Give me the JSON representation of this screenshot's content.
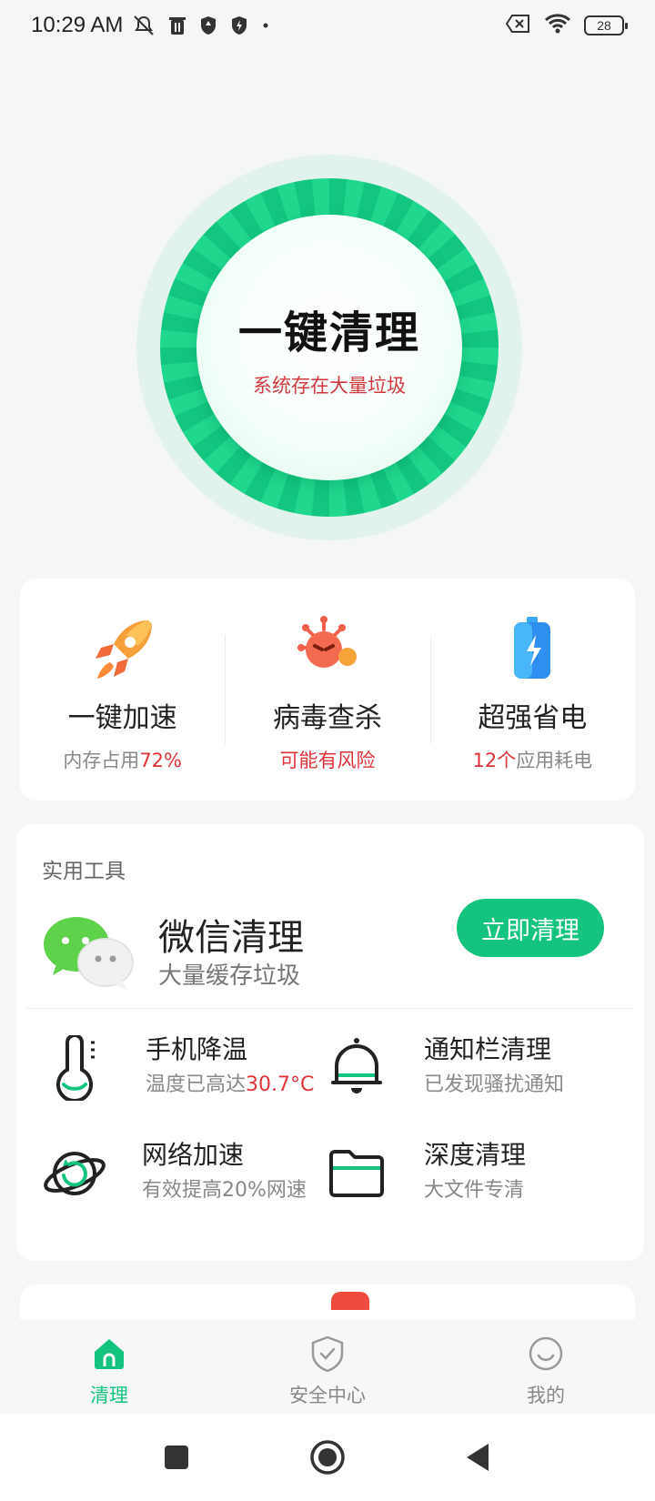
{
  "status_bar": {
    "time": "10:29 AM",
    "left_icons": [
      "mute-icon",
      "trash-icon",
      "shield-icon",
      "shield-bolt-icon",
      "dot-icon"
    ],
    "right_icons": [
      "sim-off-icon",
      "wifi-icon",
      "battery-icon"
    ],
    "battery_level": "28"
  },
  "hero": {
    "title": "一键清理",
    "subtitle": "系统存在大量垃圾",
    "ring_color": "#12c67f",
    "subtitle_color": "#d0393e"
  },
  "features": [
    {
      "icon": "rocket-icon",
      "title": "一键加速",
      "sub_prefix": "内存占用",
      "sub_highlight": "72%",
      "sub_suffix": ""
    },
    {
      "icon": "virus-icon",
      "title": "病毒查杀",
      "sub_prefix": "",
      "sub_highlight": "可能有风险",
      "sub_suffix": ""
    },
    {
      "icon": "battery-bolt-icon",
      "title": "超强省电",
      "sub_prefix": "",
      "sub_highlight": "12个",
      "sub_suffix": "应用耗电"
    }
  ],
  "tools": {
    "heading": "实用工具",
    "wechat": {
      "icon": "wechat-icon",
      "title": "微信清理",
      "subtitle": "大量缓存垃圾",
      "button": "立即清理"
    },
    "items": [
      {
        "icon": "thermometer-icon",
        "title": "手机降温",
        "sub_prefix": "温度已高达",
        "sub_highlight": "30.7°C"
      },
      {
        "icon": "bell-icon",
        "title": "通知栏清理",
        "sub_prefix": "",
        "sub_highlight": "已发现骚扰通知"
      },
      {
        "icon": "planet-icon",
        "title": "网络加速",
        "sub_prefix": "有效提高20%网速",
        "sub_highlight": ""
      },
      {
        "icon": "folder-icon",
        "title": "深度清理",
        "sub_prefix": "大文件专清",
        "sub_highlight": ""
      }
    ]
  },
  "bottom_nav": [
    {
      "icon": "home-icon",
      "label": "清理",
      "active": true
    },
    {
      "icon": "shield-check-icon",
      "label": "安全中心",
      "active": false
    },
    {
      "icon": "smile-icon",
      "label": "我的",
      "active": false
    }
  ],
  "system_nav": [
    "recents-icon",
    "home-circle-icon",
    "back-icon"
  ],
  "colors": {
    "accent": "#14c47e",
    "alert_red": "#e0343a",
    "alert_orange": "#f0a500"
  }
}
